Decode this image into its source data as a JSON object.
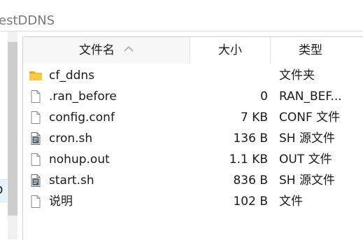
{
  "path": {
    "text": "estDDNS"
  },
  "nav": {
    "partial_label": "D"
  },
  "header": {
    "name_label": "文件名",
    "size_label": "大小",
    "type_label": "类型"
  },
  "files": [
    {
      "name": "cf_ddns",
      "size": "",
      "type": "文件夹",
      "icon": "folder-icon"
    },
    {
      "name": ".ran_before",
      "size": "0",
      "type": "RAN_BEF...",
      "icon": "blank-file-icon"
    },
    {
      "name": "config.conf",
      "size": "7 KB",
      "type": "CONF 文件",
      "icon": "blank-file-icon"
    },
    {
      "name": "cron.sh",
      "size": "136 B",
      "type": "SH 源文件",
      "icon": "script-file-icon"
    },
    {
      "name": "nohup.out",
      "size": "1.1 KB",
      "type": "OUT 文件",
      "icon": "blank-file-icon"
    },
    {
      "name": "start.sh",
      "size": "836 B",
      "type": "SH 源文件",
      "icon": "script-file-icon"
    },
    {
      "name": "说明",
      "size": "102 B",
      "type": "文件",
      "icon": "blank-file-icon"
    }
  ],
  "colors": {
    "folder": "#f8c942",
    "header_sorted_bg": "#f7f7f7",
    "selection": "#e5f1fb"
  }
}
